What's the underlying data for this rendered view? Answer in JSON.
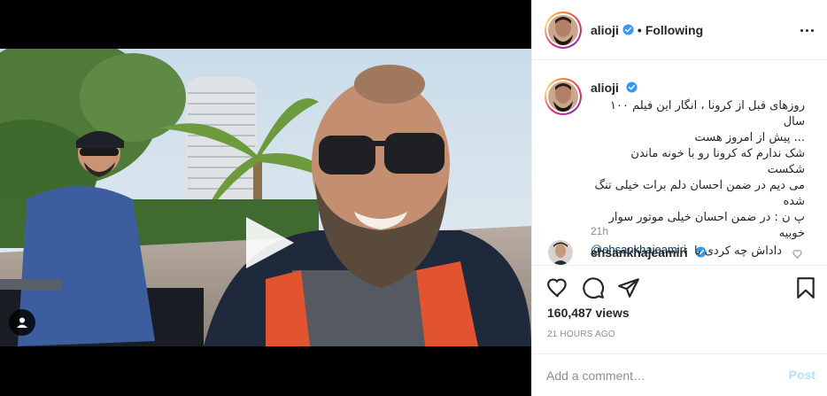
{
  "post": {
    "author": "alioji",
    "follow_state": "Following",
    "separator": "•",
    "caption_text": "روزهای قبل از کرونا ، انگار این فیلم ۱۰۰ سال\n... پیش از امروز هست\nشک ندارم که کرونا رو با خونه ماندن شکست\nمی دیم در ضمن احسان دلم برات خیلی تنگ شده\nپ ن : در ضمن احسان خیلی موتور سوار خوبیه",
    "caption_mention": "@ehsankhajeamiri",
    "time_ago": "21h",
    "views": "160,487 views",
    "posted": "21 HOURS AGO"
  },
  "comment": {
    "username": "ehsankhajeamiri",
    "text": "داداش چه کردی با"
  },
  "comment_box": {
    "placeholder": "Add a comment…",
    "post_label": "Post"
  },
  "icons": {
    "verified": "verified-badge-icon",
    "more": "more-options-icon",
    "play": "play-icon",
    "tag": "user-tag-icon",
    "like": "heart-icon",
    "comment": "comment-bubble-icon",
    "share": "paper-plane-icon",
    "save": "bookmark-icon"
  },
  "colors": {
    "verified_blue": "#3897f0",
    "link_blue": "#00376b",
    "post_disabled": "#b2dffc",
    "secondary_text": "#8e8e8e"
  }
}
